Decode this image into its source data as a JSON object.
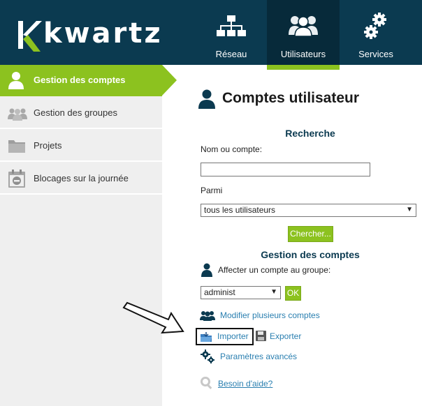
{
  "brand": {
    "logo_text": "kwartz",
    "accent": "#8cc21f",
    "header_bg": "#0b3a50"
  },
  "nav": [
    {
      "label": "Réseau",
      "icon": "network-icon",
      "active": false
    },
    {
      "label": "Utilisateurs",
      "icon": "users-icon",
      "active": true
    },
    {
      "label": "Services",
      "icon": "gears-icon",
      "active": false
    }
  ],
  "sidebar": {
    "items": [
      {
        "label": "Gestion des comptes",
        "icon": "user-icon",
        "active": true
      },
      {
        "label": "Gestion des groupes",
        "icon": "groups-icon",
        "active": false
      },
      {
        "label": "Projets",
        "icon": "folder-icon",
        "active": false
      },
      {
        "label": "Blocages sur la journée",
        "icon": "calendar-block-icon",
        "active": false
      }
    ]
  },
  "main": {
    "title": "Comptes utilisateur",
    "search": {
      "heading": "Recherche",
      "name_label": "Nom ou compte:",
      "name_value": "",
      "among_label": "Parmi",
      "among_value": "tous les utilisateurs",
      "search_button": "Chercher..."
    },
    "accounts": {
      "heading": "Gestion des comptes",
      "assign_label": "Affecter un compte au groupe:",
      "group_value": "administ",
      "ok_button": "OK",
      "modify_link": "Modifier plusieurs comptes",
      "import_link": "Importer",
      "export_link": "Exporter",
      "advanced_link": "Paramètres avancés",
      "help_link": "Besoin d'aide?"
    }
  }
}
